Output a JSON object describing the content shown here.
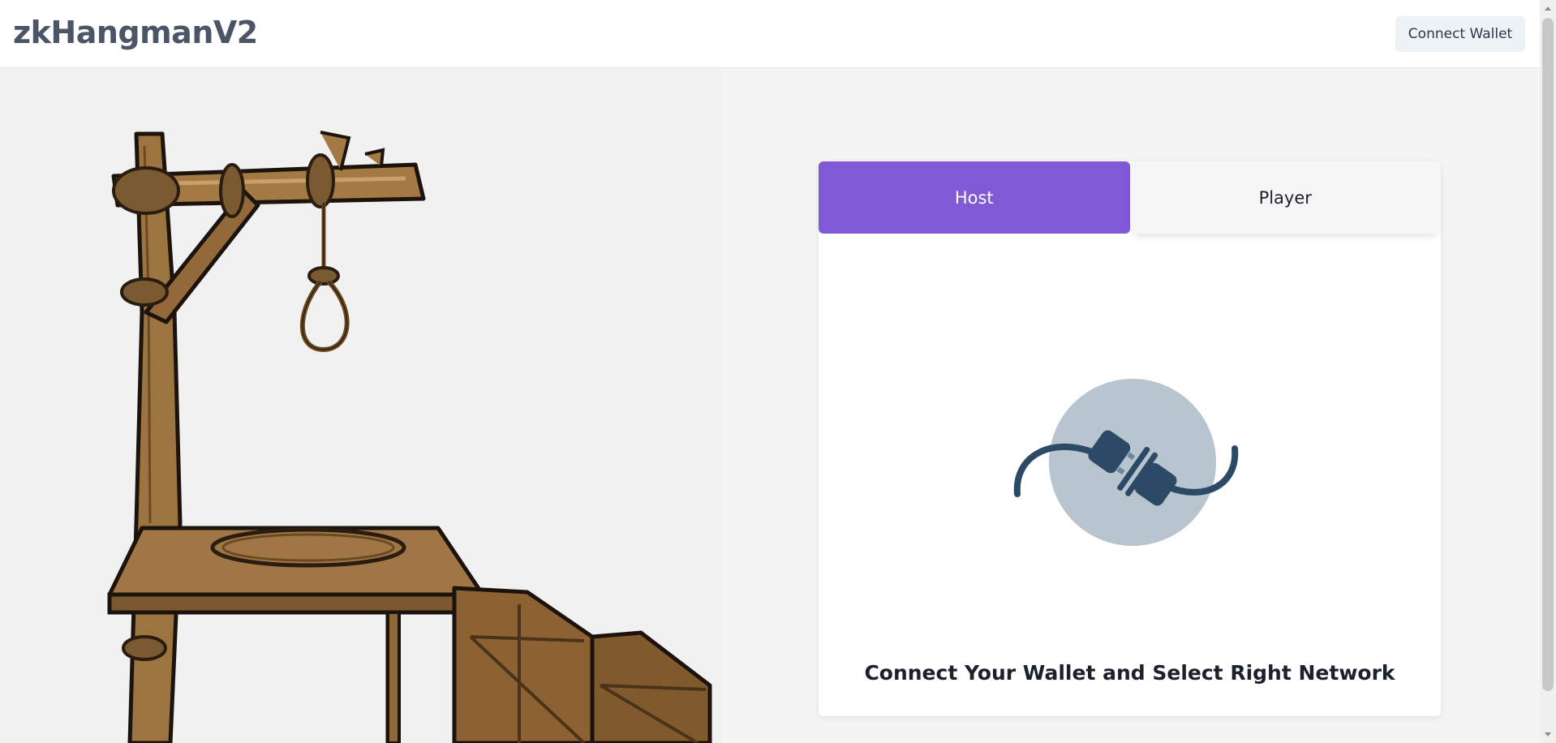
{
  "header": {
    "brand": "zkHangmanV2",
    "connect_wallet_label": "Connect Wallet"
  },
  "tabs": [
    {
      "label": "Host",
      "active": true
    },
    {
      "label": "Player",
      "active": false
    }
  ],
  "panel": {
    "message": "Connect Your Wallet and Select Right Network",
    "icon": "disconnected-plug-icon"
  },
  "illustration": {
    "icon": "gallows-illustration"
  },
  "colors": {
    "accent": "#805ad5",
    "brand_text": "#4a5568",
    "plug": "#2c4a66",
    "plug_circle": "#b8c4ce"
  }
}
